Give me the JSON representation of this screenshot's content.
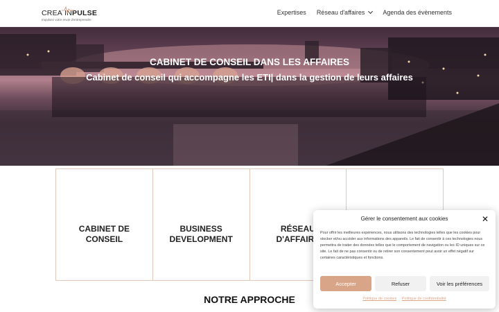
{
  "header": {
    "logo": {
      "part1": "CREA",
      "part2": "IN",
      "part3": "PULSE",
      "tagline": "Impulsez votre envie d'entreprendre"
    },
    "nav": [
      {
        "label": "Expertises"
      },
      {
        "label": "Réseau d'affaires"
      },
      {
        "label": "Agenda des évènements"
      }
    ]
  },
  "hero": {
    "title": "CABINET DE CONSEIL DANS LES AFFAIRES",
    "subtitle": "Cabinet de conseil qui accompagne les ETI| dans la gestion de leurs affaires"
  },
  "cards": [
    {
      "line1": "CABINET DE",
      "line2": "CONSEIL"
    },
    {
      "line1": "BUSINESS",
      "line2": "DEVELOPMENT"
    },
    {
      "line1": "RÉSEAU",
      "line2": "D'AFFAIRE"
    },
    {
      "line1": "",
      "line2": ""
    }
  ],
  "section_title": "NOTRE APPROCHE",
  "cookie": {
    "title": "Gérer le consentement aux cookies",
    "text": "Pour offrir les meilleures expériences, nous utilisons des technologies telles que les cookies pour stocker et/ou accéder aux informations des appareils. Le fait de consentir à ces technologies nous permettra de traiter des données telles que le comportement de navigation ou les ID uniques sur ce site. Le fait de ne pas consentir ou de retirer son consentement peut avoir un effet négatif sur certaines caractéristiques et fonctions.",
    "accept": "Accepter",
    "refuse": "Refuser",
    "prefs": "Voir les préférences",
    "link1": "Politique de cookies",
    "link2": "Politique de confidentialité",
    "accent_color": "#d9a589"
  }
}
